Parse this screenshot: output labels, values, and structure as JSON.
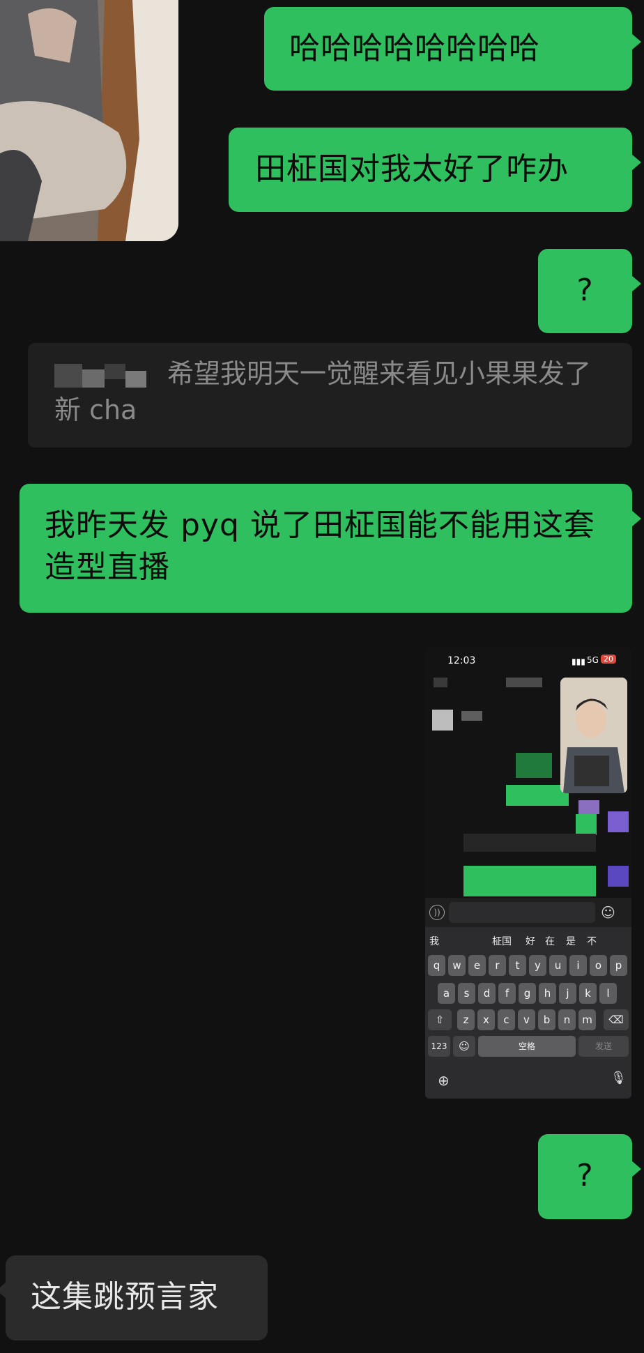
{
  "messages": [
    {
      "side": "out",
      "text": "哈哈哈哈哈哈哈哈"
    },
    {
      "side": "out",
      "text": "田柾国对我太好了咋办"
    },
    {
      "side": "out",
      "text": "?"
    },
    {
      "side": "quote",
      "text": "希望我明天一觉醒来看见小果果发了新 cha"
    },
    {
      "side": "out",
      "text": "我昨天发 pyq 说了田柾国能不能用这套造型直播"
    },
    {
      "side": "out",
      "text": "?"
    },
    {
      "side": "in",
      "text": "这集跳预言家"
    }
  ],
  "nested_screenshot": {
    "status": {
      "time": "12:03",
      "network": "5G",
      "battery": "20"
    },
    "candidates": [
      "我",
      "柾国",
      "好",
      "在",
      "是",
      "不"
    ],
    "rows": [
      [
        "q",
        "w",
        "e",
        "r",
        "t",
        "y",
        "u",
        "i",
        "o",
        "p"
      ],
      [
        "a",
        "s",
        "d",
        "f",
        "g",
        "h",
        "j",
        "k",
        "l"
      ],
      [
        "z",
        "x",
        "c",
        "v",
        "b",
        "n",
        "m"
      ]
    ],
    "num_key": "123",
    "space_key": "空格",
    "send_key": "发送"
  },
  "colors": {
    "background": "#111111",
    "outgoing": "#2fbf5f",
    "incoming": "#2b2b2b"
  }
}
